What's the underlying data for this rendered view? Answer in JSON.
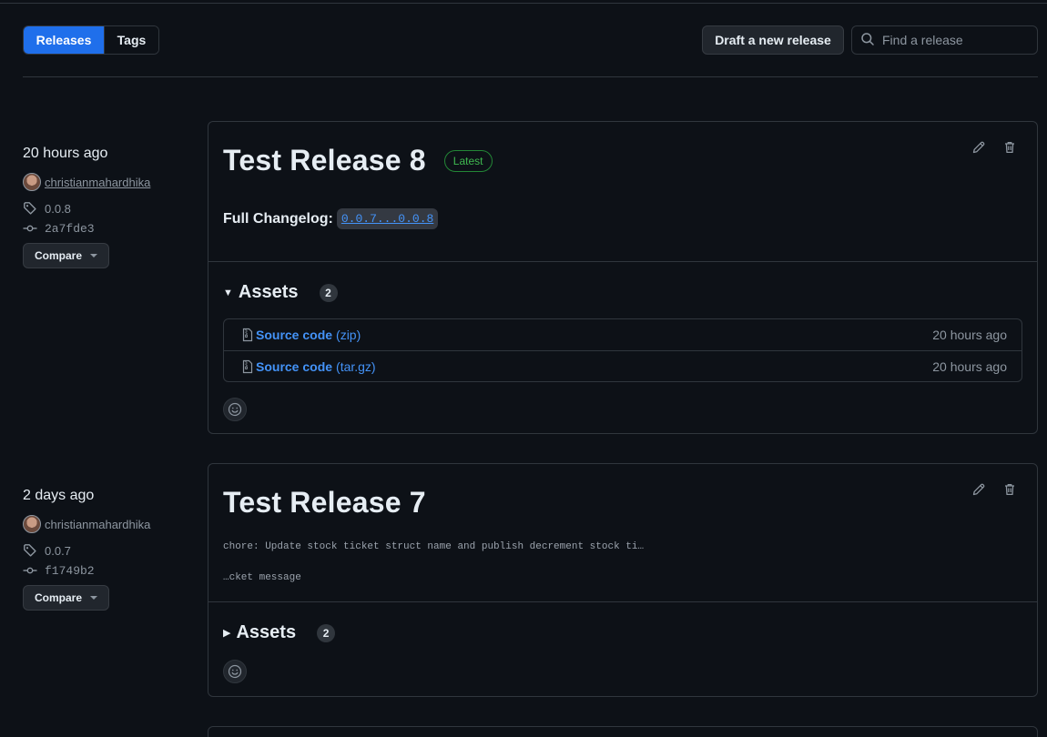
{
  "toolbar": {
    "tabs": [
      {
        "label": "Releases",
        "active": true
      },
      {
        "label": "Tags",
        "active": false
      }
    ],
    "draft_label": "Draft a new release",
    "search_placeholder": "Find a release"
  },
  "releases": [
    {
      "time": "20 hours ago",
      "author": "christianmahardhika",
      "tag": "0.0.8",
      "commit": "2a7fde3",
      "compare_label": "Compare",
      "title": "Test Release 8",
      "badge": "Latest",
      "changelog_label": "Full Changelog:",
      "changelog_link": "0.0.7...0.0.8",
      "assets_label": "Assets",
      "assets_count": "2",
      "assets_expanded": true,
      "assets": [
        {
          "name": "Source code",
          "ext": "(zip)",
          "time": "20 hours ago"
        },
        {
          "name": "Source code",
          "ext": "(tar.gz)",
          "time": "20 hours ago"
        }
      ]
    },
    {
      "time": "2 days ago",
      "author": "christianmahardhika",
      "tag": "0.0.7",
      "commit": "f1749b2",
      "compare_label": "Compare",
      "title": "Test Release 7",
      "notes": [
        "chore: Update stock ticket struct name and publish decrement stock ti…",
        "…cket message"
      ],
      "assets_label": "Assets",
      "assets_count": "2",
      "assets_expanded": false
    }
  ],
  "colors": {
    "background": "#0d1117",
    "accent": "#1f6feb",
    "link": "#4493f8",
    "latest": "#3fb950",
    "border": "#30363d"
  },
  "icons": [
    "search-icon",
    "tag-icon",
    "commit-icon",
    "pencil-icon",
    "trash-icon",
    "file-zip-icon",
    "smiley-icon",
    "triangle-down-icon",
    "triangle-right-icon"
  ]
}
